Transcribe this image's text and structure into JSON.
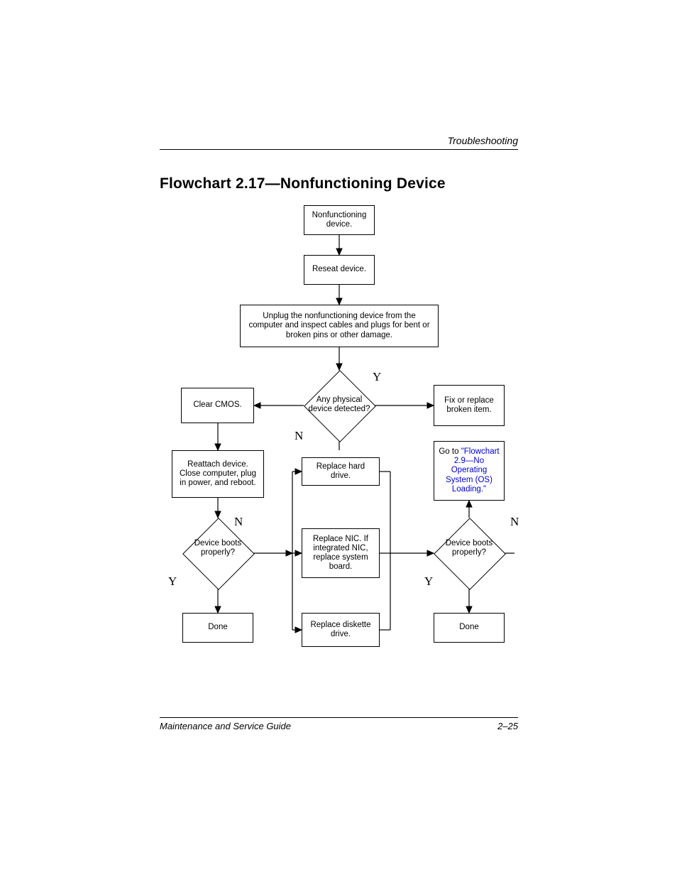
{
  "header": {
    "section": "Troubleshooting"
  },
  "title": "Flowchart 2.17—Nonfunctioning Device",
  "nodes": {
    "start": "Nonfunctioning device.",
    "reseat": "Reseat device.",
    "unplug": "Unplug the nonfunctioning device from the computer and inspect cables and plugs for bent or broken pins or other damage.",
    "decision1": "Any physical device detected?",
    "clear_cmos": "Clear CMOS.",
    "fix_replace": "Fix or replace broken item.",
    "goto_prefix": "Go to ",
    "goto_link": "\"Flowchart 2.9—No Operating System (OS) Loading.\"",
    "reattach": "Reattach device. Close computer, plug in power, and reboot.",
    "replace_hd": "Replace hard drive.",
    "replace_nic": "Replace NIC. If integrated NIC, replace system board.",
    "replace_diskette": "Replace diskette drive.",
    "decision2": "Device boots properly?",
    "decision3": "Device boots properly?",
    "done1": "Done",
    "done2": "Done"
  },
  "labels": {
    "Y": "Y",
    "N": "N"
  },
  "footer": {
    "left": "Maintenance and Service Guide",
    "right": "2–25"
  }
}
